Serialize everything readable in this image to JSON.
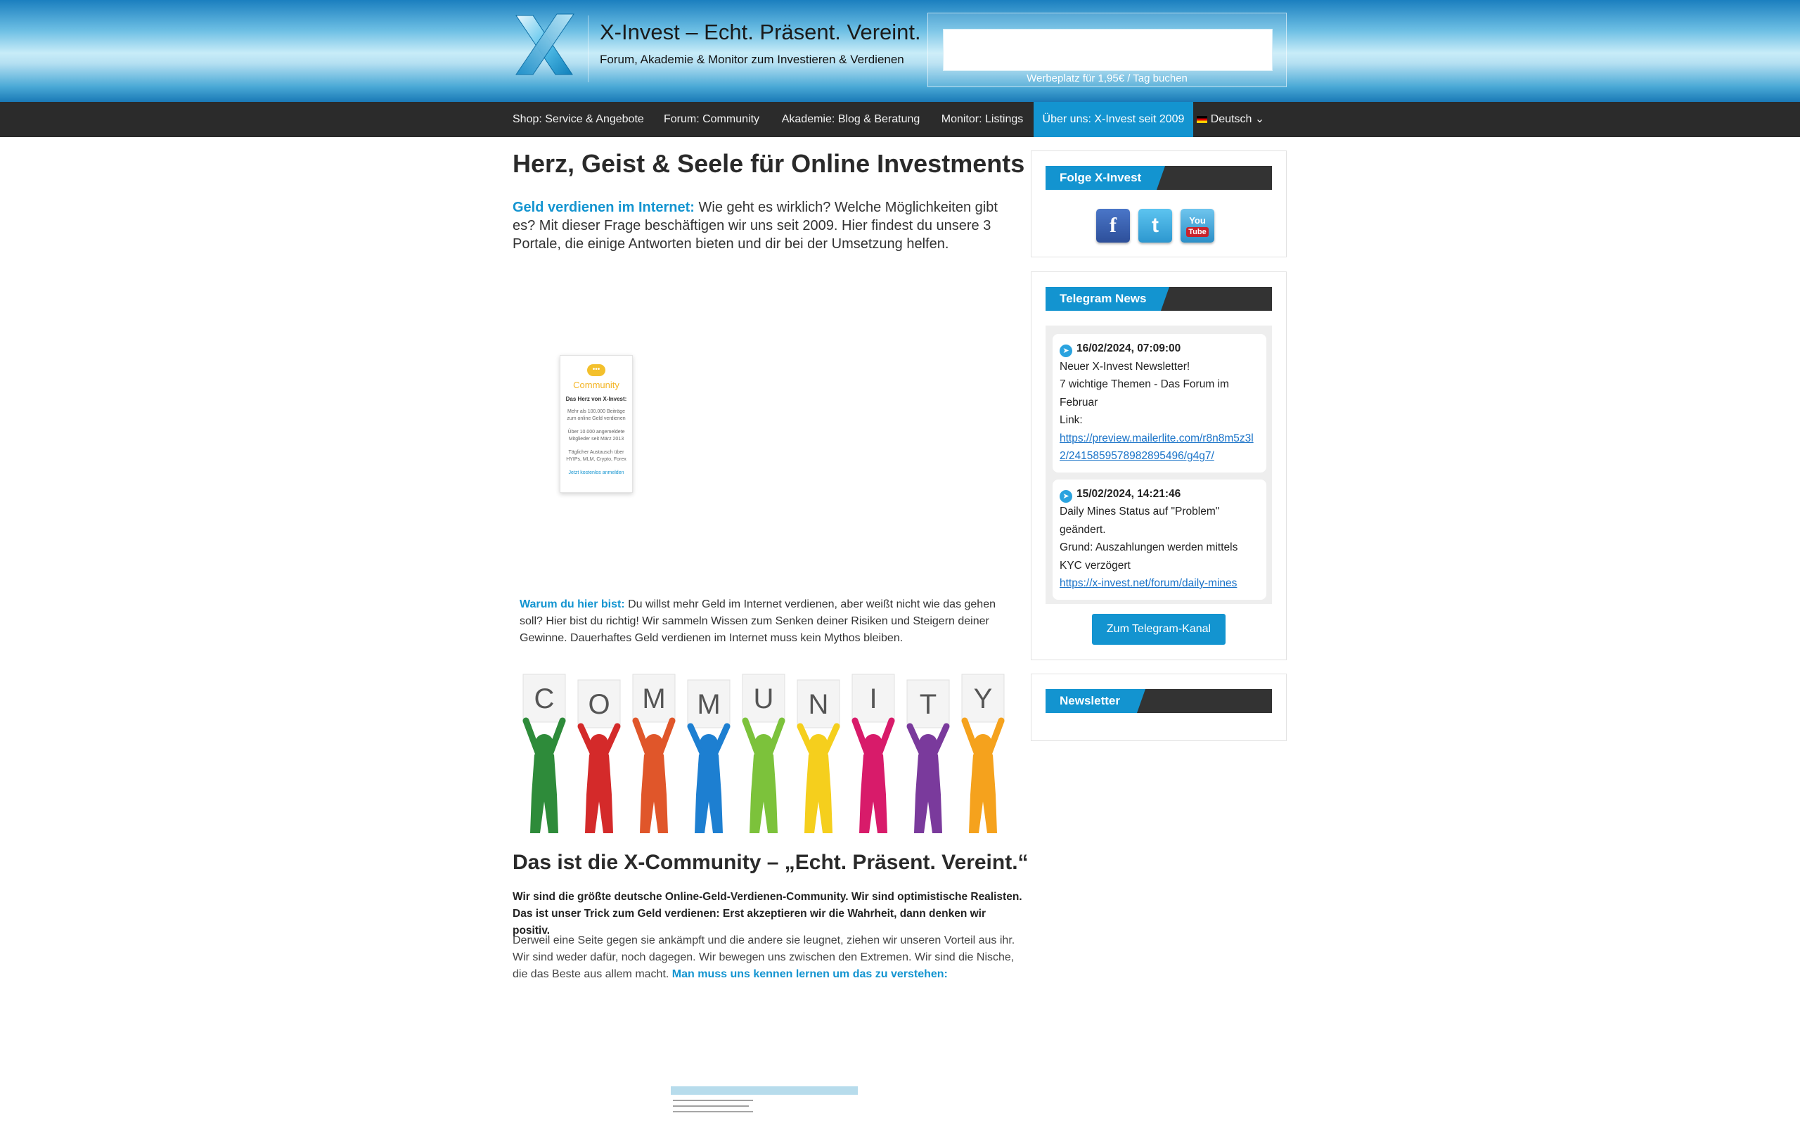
{
  "header": {
    "title": "X-Invest – Echt. Präsent. Vereint.",
    "tagline": "Forum, Akademie & Monitor zum Investieren & Verdienen",
    "ad_link": "Werbeplatz für 1,95€ / Tag buchen"
  },
  "nav": {
    "items": [
      {
        "label": "Shop: Service & Angebote"
      },
      {
        "label": "Forum: Community"
      },
      {
        "label": "Akademie: Blog & Beratung"
      },
      {
        "label": "Monitor: Listings"
      },
      {
        "label": "Über uns: X-Invest seit 2009"
      }
    ],
    "language": "Deutsch",
    "language_chevron": "⌄"
  },
  "main": {
    "title": "Herz, Geist & Seele für Online Investments",
    "intro_highlight": "Geld verdienen im Internet:",
    "intro_text": " Wie geht es wirklich? Welche Möglichkeiten gibt es? Mit dieser Frage beschäftigen wir uns seit 2009. Hier findest du unsere 3 Portale, die einige Antworten bieten und dir bei der Umsetzung helfen.",
    "widget": {
      "title": "Community",
      "subtitle": "Das Herz von X-Invest:",
      "line1": "Mehr als 100.000 Beiträge zum online Geld verdienen",
      "line2": "Über 10.000 angemeldete Mitglieder seit März 2013",
      "line3": "Täglicher Austausch über HYIPs, MLM, Crypto, Forex",
      "link": "Jetzt kostenlos anmelden"
    },
    "why_label": "Warum du hier bist:",
    "why_text": " Du willst mehr Geld im Internet verdienen, aber weißt nicht wie das gehen soll? Hier bist du richtig! Wir sammeln Wissen zum Senken deiner Risiken und Steigern deiner Gewinne. Dauerhaftes Geld verdienen im Internet muss kein Mythos bleiben.",
    "community_letters": [
      "C",
      "O",
      "M",
      "M",
      "U",
      "N",
      "I",
      "T",
      "Y"
    ],
    "community_title": "Das ist die X-Community – „Echt. Präsent. Vereint.“",
    "community_bold": "Wir sind die größte deutsche Online-Geld-Verdienen-Community. Wir sind optimistische Realisten. Das ist unser Trick zum Geld verdienen: Erst akzeptieren wir die Wahrheit, dann denken wir positiv.",
    "community_body": "Derweil eine Seite gegen sie ankämpft und die andere sie leugnet, ziehen wir unseren Vorteil aus ihr. Wir sind weder dafür, noch dagegen. Wir bewegen uns zwischen den Extremen. Wir sind die Nische, die das Beste aus allem macht. ",
    "community_link": "Man muss uns kennen lernen um das zu verstehen:"
  },
  "sidebar": {
    "follow_title": "Folge X-Invest auf:",
    "social": {
      "facebook": "f",
      "twitter": "t",
      "youtube_top": "You",
      "youtube_bottom": "Tube"
    },
    "telegram_title": "Telegram News",
    "telegram_posts": [
      {
        "time": "16/02/2024, 07:09:00",
        "lines": [
          "Neuer X-Invest Newsletter!",
          "7 wichtige Themen - Das Forum im Februar",
          "Link:"
        ],
        "link": "https://preview.mailerlite.com/r8n8m5z3l2/2415859578982895496/g4g7/"
      },
      {
        "time": "15/02/2024, 14:21:46",
        "lines": [
          "Daily Mines Status auf \"Problem\" geändert.",
          "Grund: Auszahlungen werden mittels KYC verzögert"
        ],
        "link": "https://x-invest.net/forum/daily-mines"
      }
    ],
    "telegram_button": "Zum Telegram-Kanal",
    "newsletter_title": "Newsletter"
  },
  "colors": {
    "accent": "#1394d0",
    "nav_bg": "#2b2b2b",
    "widget_head": "#333333"
  }
}
